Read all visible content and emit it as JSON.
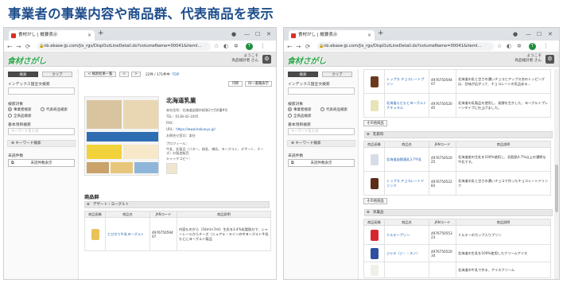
{
  "heading": "事業者の事業内容や商品群、代表商品を表示",
  "browser": {
    "tab_title": "食材がし | 概要表示",
    "url": "nb.ebase-jp.com/jis_rgs/DispOutLineDetail.do?volumeName=00041&itemI..."
  },
  "site": {
    "logo": "食材さがし",
    "user_line1": "ようこそ",
    "user_line2": "商品検討者 さん"
  },
  "sidebar": {
    "search_button": "検索",
    "clear_button": "クリア",
    "index_label": "インデックス固全文検索",
    "target_label": "検索対象",
    "radio_business": "事業者検索",
    "radio_rep": "代表商品検索",
    "radio_all": "全商品検索",
    "basic_label": "基本項目検索",
    "keyword_placeholder": "キーワードを入力",
    "keyword_bar": "キーワード検索",
    "unread_label": "未読件数",
    "unread_button": "未読件数表示"
  },
  "toolbar": {
    "back_button": "< 検索結果一覧",
    "prev": "<",
    "next": ">",
    "page_info": "22件 / 171件中",
    "top_link": "TOP",
    "print_button": "印刷",
    "compare_button": "同一書籍表示"
  },
  "company": {
    "name": "北海道乳業",
    "address": "本社住所：北海道函館市昭和2丁目6番9号",
    "tel": "TEL：0138-42-1045",
    "fax": "FAX：",
    "url_label": "URL：",
    "url": "https://www.hokunyu.jp/",
    "hq": "お問合せ窓口：本社",
    "profile_label": "プロフィール：",
    "profile": "牛乳、乳製品（バター、粉乳、練乳、ヨーグルト、デザート、チーズ）の製造販売",
    "catch_label": "キャッチコピー："
  },
  "products_section": {
    "title": "商品群",
    "category": "デザート・ヨーグルト",
    "headers": [
      "商品画像",
      "商品名",
      "JANコード",
      "商品説明"
    ],
    "rows": [
      {
        "name": "とびきり牛乳ヨーグルト",
        "jan": "4976750594 07",
        "desc": "内容ものから（16ml×7ml）生乳を3.4%乳脂肪分で、シャーレールからチーズ（ニュアキ・ラインの中ヨーグルト牛乳もとにヨーグルト製品"
      }
    ]
  },
  "right_panel": {
    "top_rows": [
      {
        "name": "トップス チョコレートプリン",
        "jan": "4976750594 07",
        "desc": "北海道の乳と甘さの濃いチョコとアップス合のトッピングは、甘味が広がって、チョコレートの気品ある..."
      },
      {
        "name": "北海道えだもとヨーグルト ナチュラル",
        "jan": "4976750520 45",
        "desc": "北海道の乳製品を使用し、発酵を生かした、ヨーグルトプレーンタイプに仕上げました。"
      }
    ],
    "more_button": "その他商品",
    "milk_category": "乳飲料",
    "milk_rows": [
      {
        "name": "北海道函館連乳3.7牛乳",
        "jan": "4976750520 25",
        "desc": "北海道産の生乳を100%使用し、乳脂肪3.7%以上の濃厚な牛乳です。"
      },
      {
        "name": "トップス チョコレートドリンク",
        "jan": "4976750522 83",
        "desc": "北海道の乳と甘さの濃いチョコで作ったチョコレートドリンク"
      }
    ],
    "frozen_category": "氷菓品",
    "frozen_rows": [
      {
        "name": "ミルキープリン",
        "jan": "4976750553 23",
        "desc": "ミルキーのカップ入りプリン"
      },
      {
        "name": "ジャキ（ジ・・スノ）",
        "jan": "4976750520 34",
        "desc": "北海道の生乳を100%使用したクリームアイス"
      },
      {
        "name": "",
        "jan": "",
        "desc": "北海道の牛乳で作る、アイスクリーム"
      }
    ],
    "headers": [
      "商品画像",
      "商品名",
      "JANコード",
      "商品説明"
    ]
  },
  "colors": {
    "heading": "#1f4e8c",
    "logo": "#2aa54a",
    "link": "#1a5fb4"
  }
}
